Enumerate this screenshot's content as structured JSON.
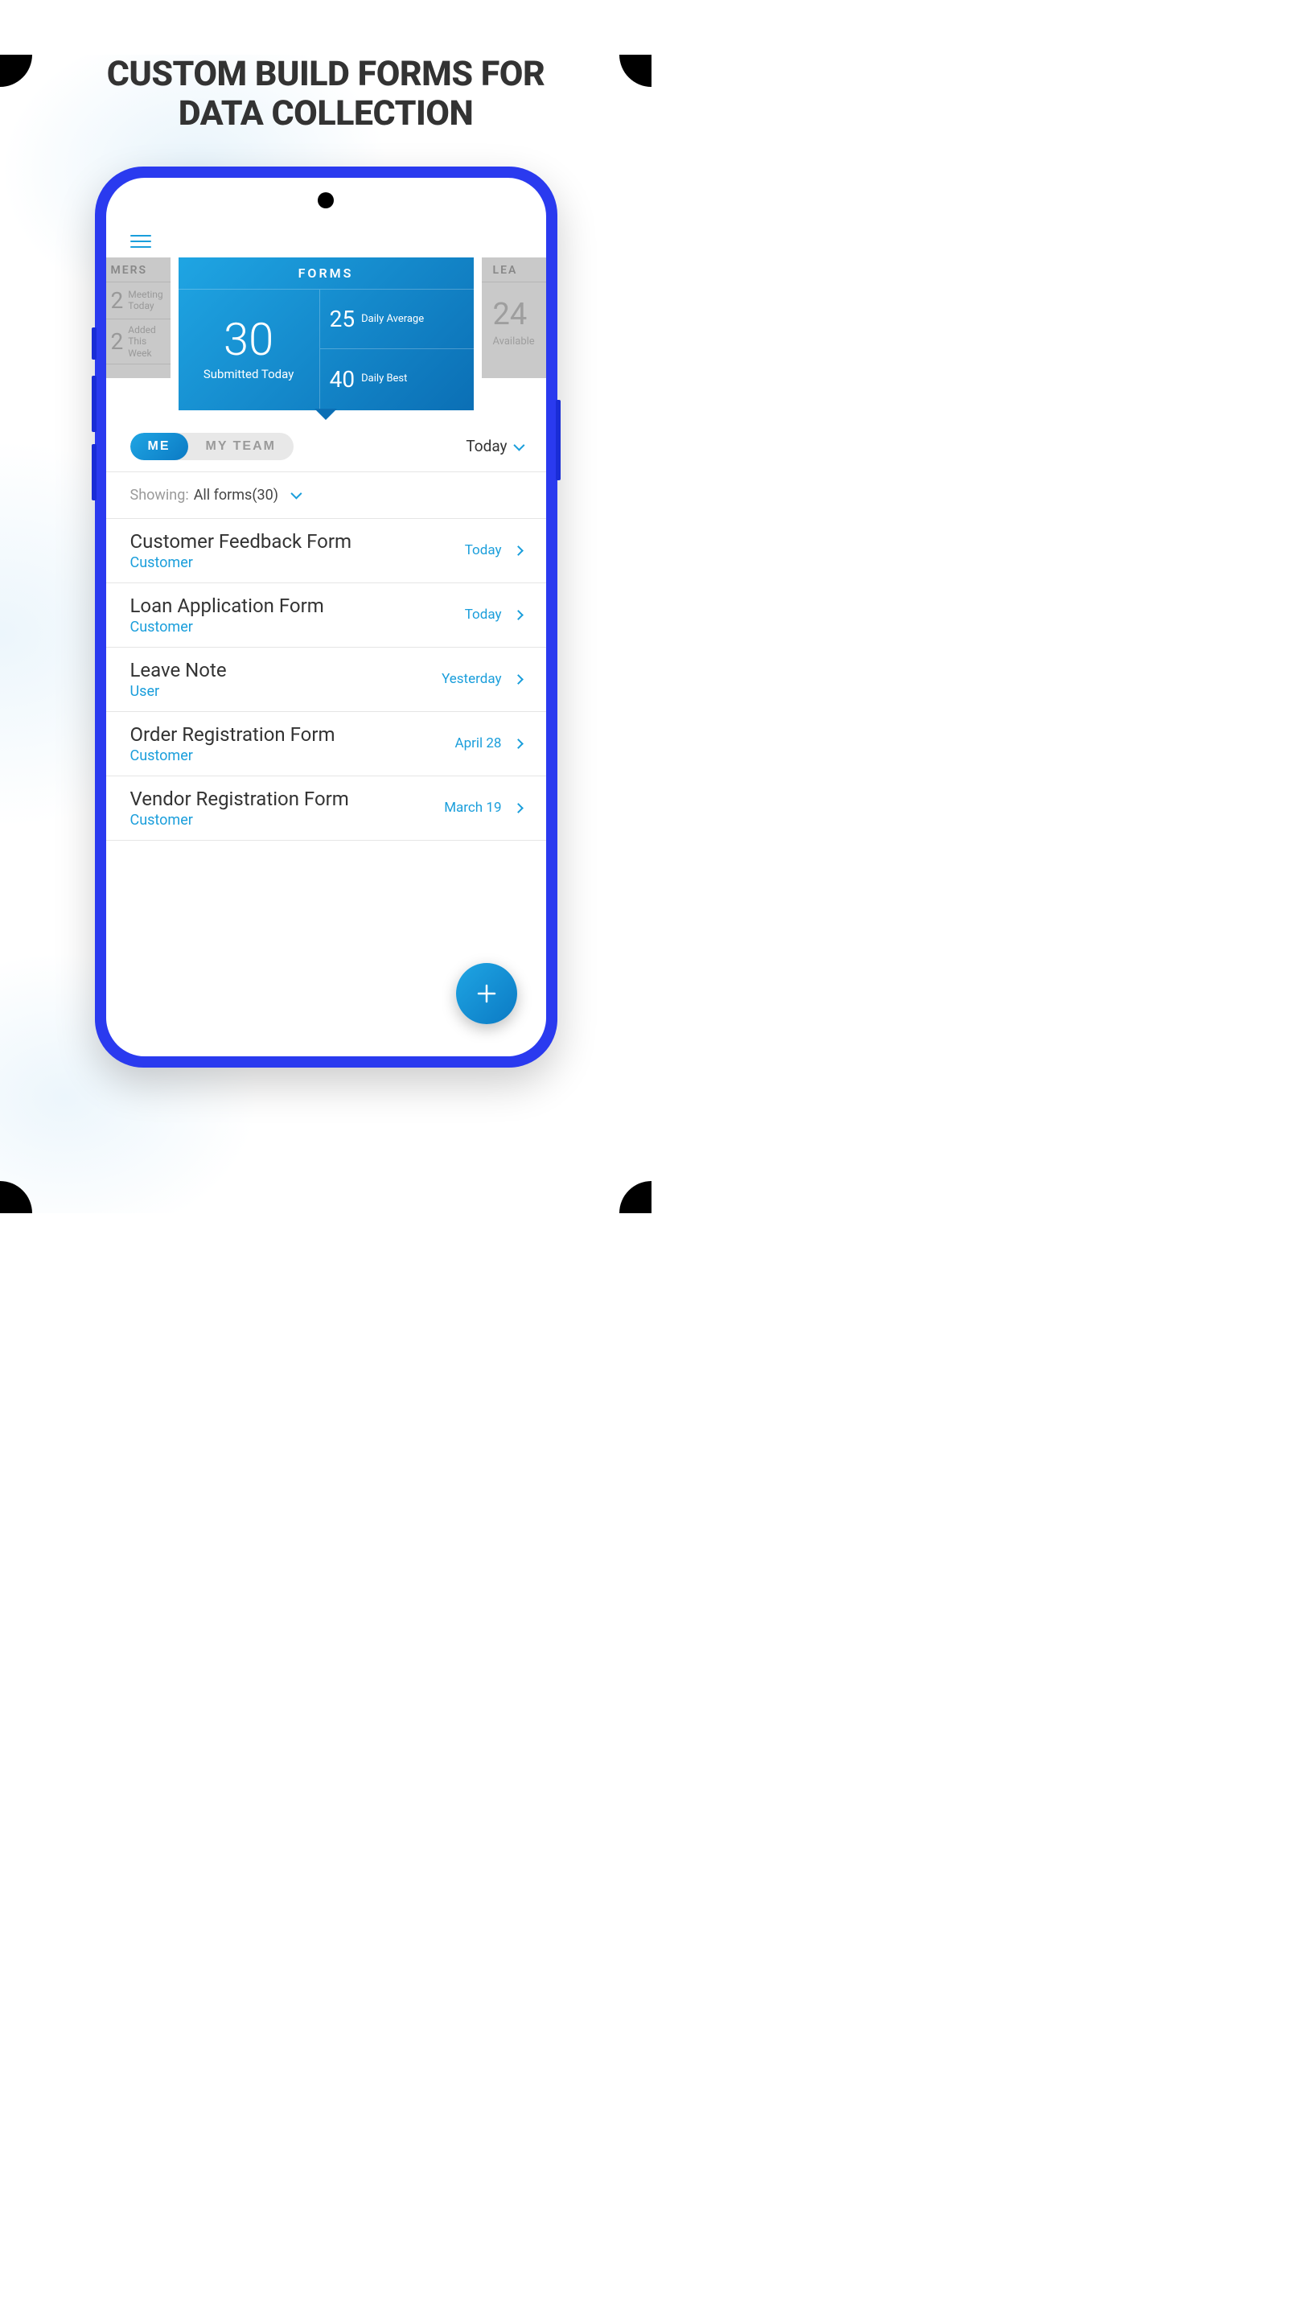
{
  "marketing": {
    "title_line1": "CUSTOM BUILD FORMS FOR",
    "title_line2": "DATA COLLECTION"
  },
  "cards": {
    "left": {
      "header": "MERS",
      "rows": [
        {
          "num": "2",
          "label": "Meeting Today"
        },
        {
          "num": "2",
          "label": "Added This Week"
        }
      ]
    },
    "main": {
      "header": "FORMS",
      "big_value": "30",
      "big_label": "Submitted Today",
      "stats": [
        {
          "value": "25",
          "label": "Daily Average"
        },
        {
          "value": "40",
          "label": "Daily Best"
        }
      ]
    },
    "right": {
      "header": "LEA",
      "value": "24",
      "label": "Available"
    }
  },
  "toggle": {
    "me": "ME",
    "my_team": "MY TEAM"
  },
  "date_filter": {
    "label": "Today"
  },
  "filter": {
    "label": "Showing:",
    "value": "All forms(30)"
  },
  "forms": [
    {
      "title": "Customer Feedback Form",
      "category": "Customer",
      "date": "Today"
    },
    {
      "title": "Loan Application Form",
      "category": "Customer",
      "date": "Today"
    },
    {
      "title": "Leave Note",
      "category": "User",
      "date": "Yesterday"
    },
    {
      "title": "Order Registration Form",
      "category": "Customer",
      "date": "April 28"
    },
    {
      "title": "Vendor Registration Form",
      "category": "Customer",
      "date": "March 19"
    }
  ]
}
